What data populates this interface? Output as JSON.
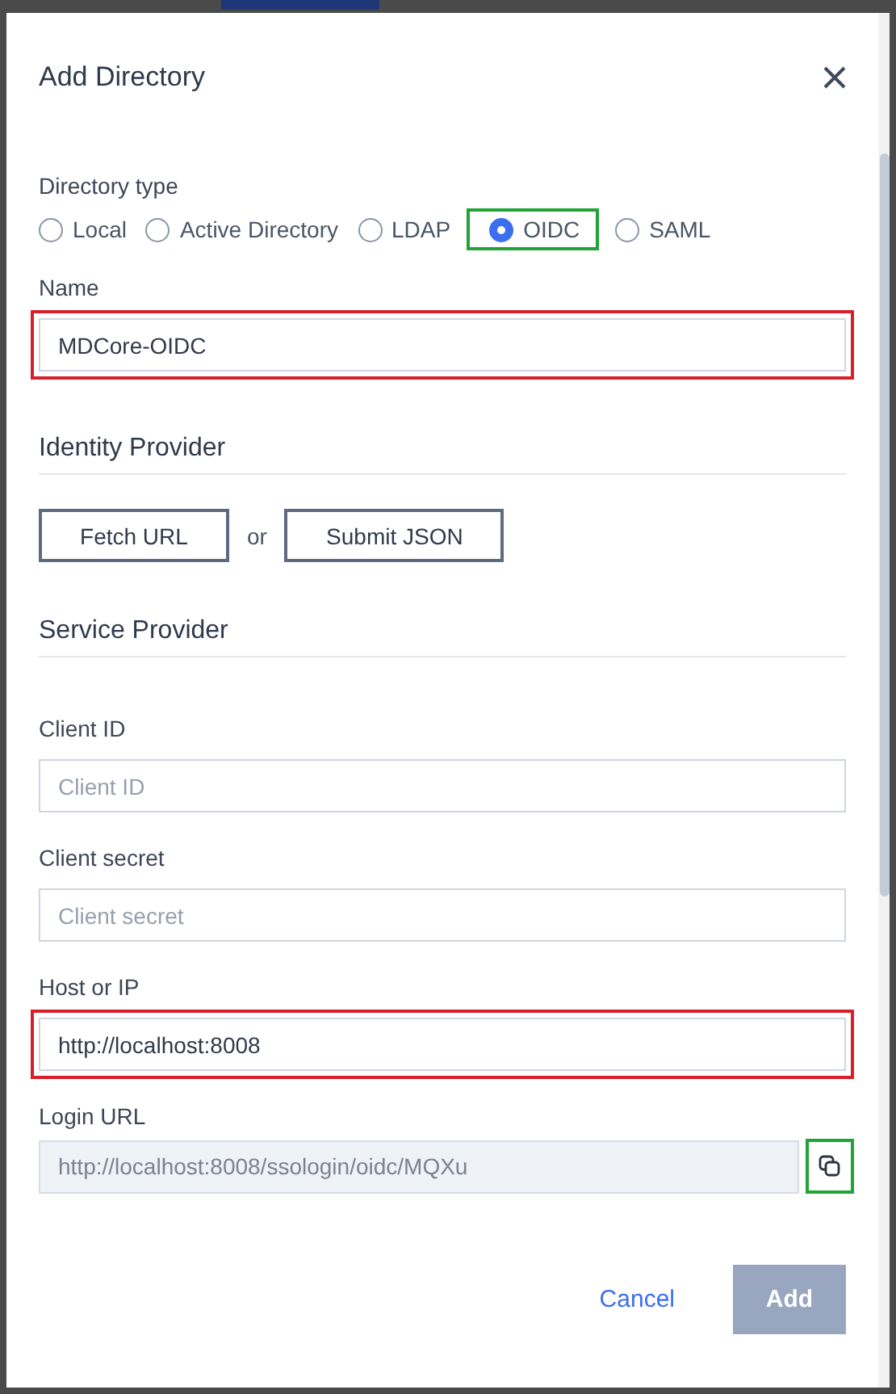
{
  "dialog": {
    "title": "Add Directory"
  },
  "directory_type": {
    "label": "Directory type",
    "options": [
      {
        "label": "Local",
        "selected": false,
        "highlighted": false
      },
      {
        "label": "Active Directory",
        "selected": false,
        "highlighted": false
      },
      {
        "label": "LDAP",
        "selected": false,
        "highlighted": false
      },
      {
        "label": "OIDC",
        "selected": true,
        "highlighted": true
      },
      {
        "label": "SAML",
        "selected": false,
        "highlighted": false
      }
    ]
  },
  "name": {
    "label": "Name",
    "value": "MDCore-OIDC",
    "highlighted": true
  },
  "identity_provider": {
    "heading": "Identity Provider",
    "buttons": [
      "Fetch URL",
      "Submit JSON"
    ],
    "separator": "or"
  },
  "service_provider": {
    "heading": "Service Provider",
    "fields": [
      {
        "kind": "text",
        "label": "Client ID",
        "placeholder": "Client ID",
        "highlighted": false
      },
      {
        "kind": "text",
        "label": "Client secret",
        "placeholder": "Client secret",
        "highlighted": false
      },
      {
        "kind": "text",
        "label": "Host or IP",
        "value": "http://localhost:8008",
        "highlighted": true
      },
      {
        "kind": "readonly",
        "label": "Login URL",
        "value": "http://localhost:8008/ssologin/oidc/MQXu",
        "highlighted": true
      }
    ]
  },
  "footer": {
    "cancel": "Cancel",
    "submit": "Add",
    "submit_disabled": true
  }
}
